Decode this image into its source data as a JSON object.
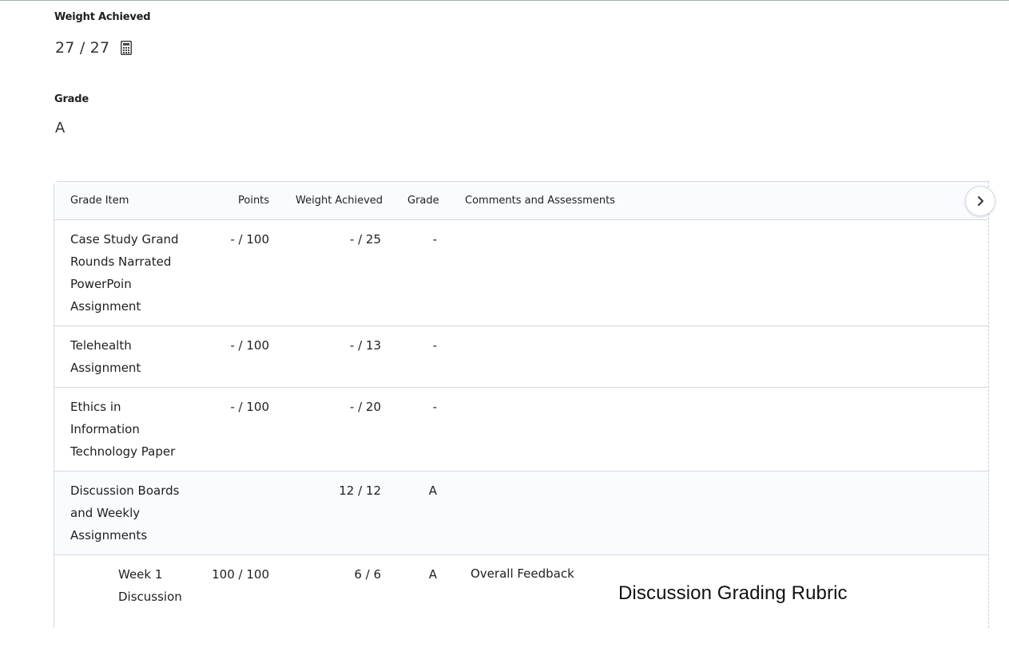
{
  "summary": {
    "weight_label": "Weight Achieved",
    "weight_value": "27 / 27",
    "grade_label": "Grade",
    "grade_value": "A"
  },
  "table": {
    "headers": {
      "item": "Grade Item",
      "points": "Points",
      "weight": "Weight Achieved",
      "grade": "Grade",
      "comments": "Comments and Assessments"
    },
    "rows": [
      {
        "item": "Case Study Grand Rounds Narrated PowerPoin Assignment",
        "points": "- / 100",
        "weight": "- / 25",
        "grade": "-"
      },
      {
        "item": "Telehealth Assignment",
        "points": "- / 100",
        "weight": "- / 13",
        "grade": "-"
      },
      {
        "item": "Ethics in Information Technology Paper",
        "points": "- / 100",
        "weight": "- / 20",
        "grade": "-"
      },
      {
        "item": "Discussion Boards and Weekly Assignments",
        "points": "",
        "weight": "12 / 12",
        "grade": "A"
      },
      {
        "item": "Week 1 Discussion",
        "points": "100 / 100",
        "weight": "6 / 6",
        "grade": "A",
        "feedback_label": "Overall Feedback",
        "feedback_title": "Discussion Grading Rubric"
      }
    ]
  },
  "icons": {
    "calculator": "calculator-icon",
    "scroll_right": "chevron-right-icon"
  }
}
